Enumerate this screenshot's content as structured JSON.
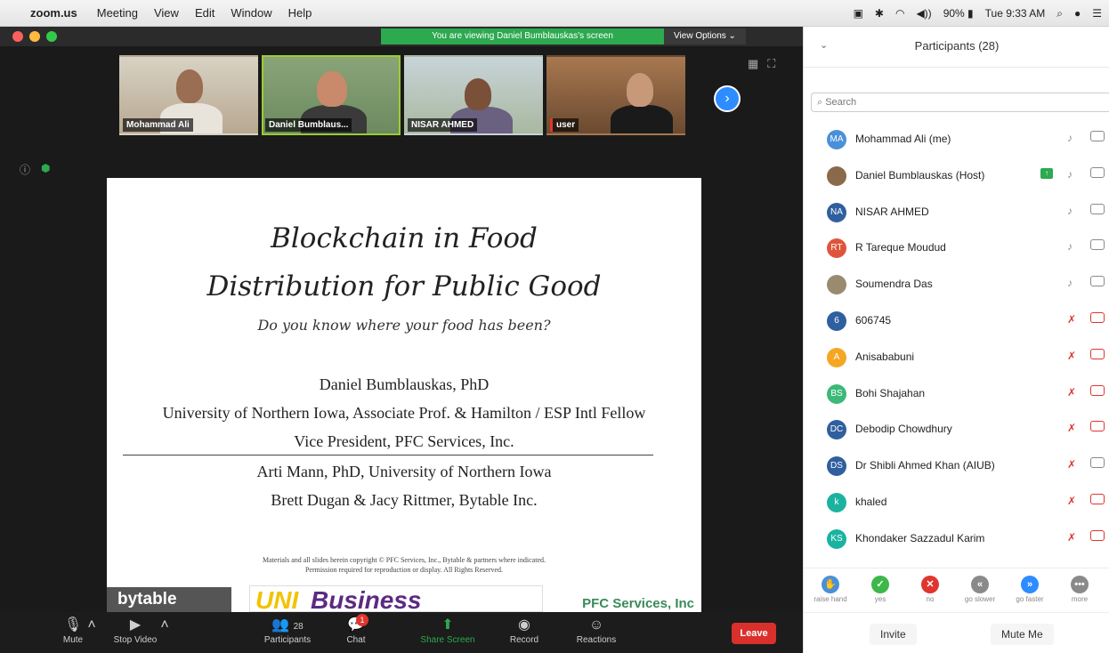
{
  "menubar": {
    "app": "zoom.us",
    "items": [
      "Meeting",
      "View",
      "Edit",
      "Window",
      "Help"
    ],
    "status": {
      "volume_icon": "◀))",
      "battery": "90%",
      "clock": "Tue 9:33 AM"
    }
  },
  "banner": {
    "text": "You are viewing Daniel Bumblauskas's screen",
    "view_options": "View Options ⌄"
  },
  "thumbnails": [
    {
      "name": "Mohammad Ali"
    },
    {
      "name": "Daniel Bumblaus..."
    },
    {
      "name": "NISAR AHMED"
    },
    {
      "name": "user"
    }
  ],
  "slide": {
    "title_line1": "Blockchain in Food",
    "title_line2": "Distribution for Public Good",
    "subtitle": "Do you know where your food has been?",
    "author": "Daniel Bumblauskas, PhD",
    "affiliation": "University of Northern Iowa, Associate Prof. & Hamilton / ESP Intl Fellow",
    "role": "Vice President, PFC Services, Inc.",
    "coauthor1": "Arti Mann, PhD, University of Northern Iowa",
    "coauthor2": "Brett Dugan & Jacy Rittmer, Bytable Inc.",
    "copyright1": "Materials and all slides herein copyright © PFC Services, Inc., Bytable & partners where indicated.",
    "copyright2": "Permission required for reproduction or display. All Rights Reserved.",
    "logo_bytable": "bytable",
    "logo_uni": "UNI",
    "logo_business": "Business",
    "logo_pfc": "PFC Services, Inc"
  },
  "toolbar": {
    "mute": "Mute",
    "stop_video": "Stop Video",
    "participants": "Participants",
    "participants_count": "28",
    "chat": "Chat",
    "chat_badge": "1",
    "share": "Share Screen",
    "record": "Record",
    "reactions": "Reactions",
    "leave": "Leave"
  },
  "panel": {
    "title": "Participants (28)",
    "search_placeholder": "Search",
    "participants": [
      {
        "initials": "MA",
        "name": "Mohammad Ali (me)",
        "color": "#4a90d9",
        "muted": false,
        "video_off": false
      },
      {
        "initials": "",
        "name": "Daniel Bumblauskas (Host)",
        "color": "#8a6a4a",
        "muted": false,
        "video_off": false,
        "sharing": true
      },
      {
        "initials": "NA",
        "name": "NISAR AHMED",
        "color": "#2f5f9e",
        "muted": false,
        "video_off": false
      },
      {
        "initials": "RT",
        "name": "R Tareque Moudud",
        "color": "#e0543c",
        "muted": false,
        "video_off": false
      },
      {
        "initials": "",
        "name": "Soumendra Das",
        "color": "#9a8a70",
        "muted": false,
        "video_off": false
      },
      {
        "initials": "6",
        "name": "606745",
        "color": "#2f5f9e",
        "muted": true,
        "video_off": true
      },
      {
        "initials": "A",
        "name": "Anisababuni",
        "color": "#f5a623",
        "muted": true,
        "video_off": true
      },
      {
        "initials": "BS",
        "name": "Bohi Shajahan",
        "color": "#3cb878",
        "muted": true,
        "video_off": true
      },
      {
        "initials": "DC",
        "name": "Debodip Chowdhury",
        "color": "#2f5f9e",
        "muted": true,
        "video_off": true
      },
      {
        "initials": "DS",
        "name": "Dr Shibli Ahmed Khan (AIUB)",
        "color": "#2f5f9e",
        "muted": true,
        "video_off": false
      },
      {
        "initials": "k",
        "name": "khaled",
        "color": "#1bb3a0",
        "muted": true,
        "video_off": true
      },
      {
        "initials": "KS",
        "name": "Khondaker Sazzadul Karim",
        "color": "#1bb3a0",
        "muted": true,
        "video_off": true
      }
    ],
    "reactions": [
      {
        "label": "raise hand",
        "color": "#4a90d9",
        "glyph": "✋"
      },
      {
        "label": "yes",
        "color": "#3cb84a",
        "glyph": "✓"
      },
      {
        "label": "no",
        "color": "#e0352f",
        "glyph": "✕"
      },
      {
        "label": "go slower",
        "color": "#8a8a8a",
        "glyph": "«"
      },
      {
        "label": "go faster",
        "color": "#2d8cff",
        "glyph": "»"
      },
      {
        "label": "more",
        "color": "#8a8a8a",
        "glyph": "•••"
      }
    ],
    "invite": "Invite",
    "mute_me": "Mute Me"
  }
}
